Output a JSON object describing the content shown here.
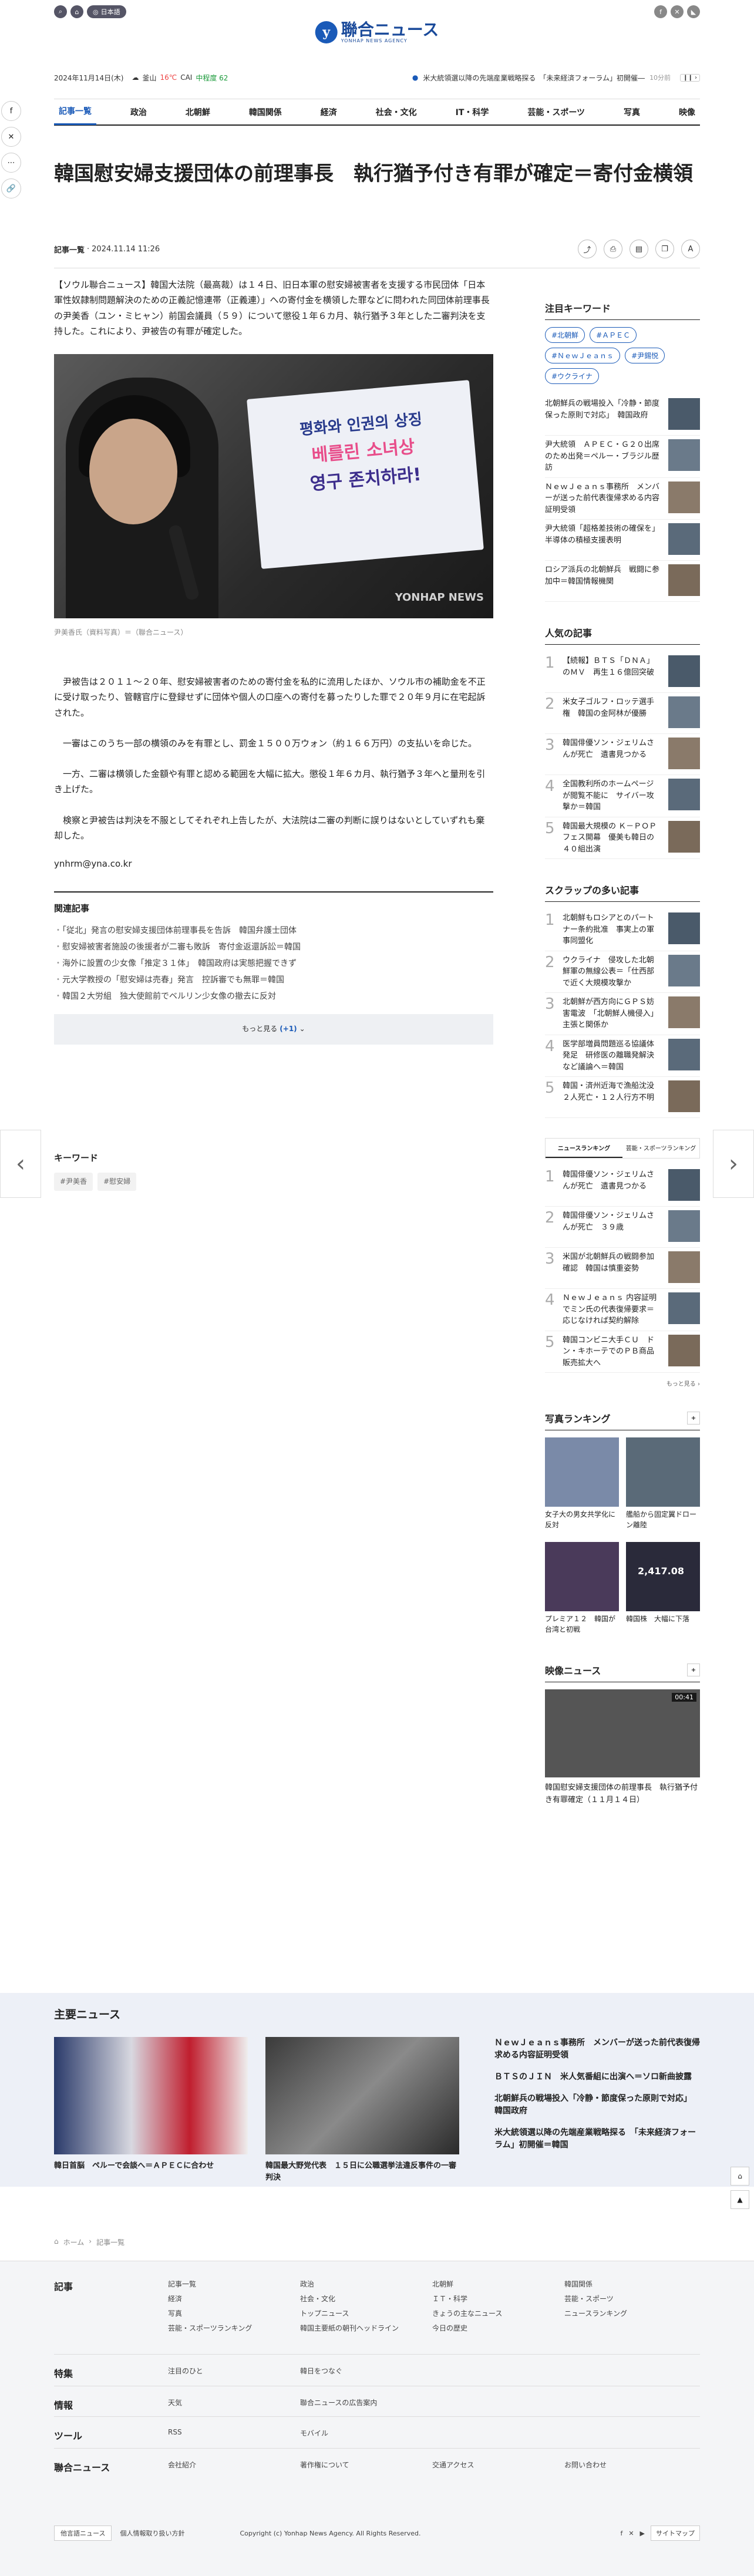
{
  "header": {
    "lang": "日本語",
    "logo": "聯合ニュース",
    "logo_sub": "YONHAP NEWS AGENCY"
  },
  "info": {
    "date": "2024年11月14日(木)",
    "city": "釜山",
    "temp": "16℃",
    "cai_label": "CAI",
    "cai": "中程度 62",
    "ticker": "米大統領選以降の先端産業戦略探る　「未来経済フォーラム」初開催―",
    "ago": "10分前"
  },
  "nav": [
    "記事一覧",
    "政治",
    "北朝鮮",
    "韓国関係",
    "経済",
    "社会・文化",
    "IT・科学",
    "芸能・スポーツ",
    "写真",
    "映像"
  ],
  "article": {
    "title": "韓国慰安婦支援団体の前理事長　執行猶予付き有罪が確定＝寄付金横領",
    "category": "記事一覧",
    "datetime": "2024.11.14 11:26",
    "lead": "【ソウル聯合ニュース】韓国大法院（最高裁）は１４日、旧日本軍の慰安婦被害者を支援する市民団体「日本軍性奴隷制問題解決のための正義記憶連帯（正義連）」への寄付金を横領した罪などに問われた同団体前理事長の尹美香（ユン・ミヒャン）前国会議員（５９）について懲役１年６カ月、執行猶予３年とした二審判決を支持した。これにより、尹被告の有罪が確定した。",
    "caption": "尹美香氏（資料写真）＝（聯合ニュース）",
    "p1": "尹被告は２０１１～２０年、慰安婦被害者のための寄付金を私的に流用したほか、ソウル市の補助金を不正に受け取ったり、管轄官庁に登録せずに団体や個人の口座への寄付を募ったりした罪で２０年９月に在宅起訴された。",
    "p2": "一審はこのうち一部の横領のみを有罪とし、罰金１５００万ウォン（約１６６万円）の支払いを命じた。",
    "p3": "一方、二審は横領した金額や有罪と認める範囲を大幅に拡大。懲役１年６カ月、執行猶予３年へと量刑を引き上げた。",
    "p4": "検察と尹被告は判決を不服としてそれぞれ上告したが、大法院は二審の判断に誤りはないとしていずれも棄却した。",
    "email": "ynhrm@yna.co.kr",
    "sign": {
      "l1": "평화와 인권의 상징",
      "l2": "베를린 소녀상",
      "l3": "영구 존치하라!"
    },
    "watermark": "YONHAP NEWS"
  },
  "related": {
    "heading": "関連記事",
    "items": [
      "「従北」発言の慰安婦支援団体前理事長を告訴　韓国弁護士団体",
      "慰安婦被害者施設の後援者が二審も敗訴　寄付金返還訴訟＝韓国",
      "海外に設置の少女像「推定３１体」　韓国政府は実態把握できず",
      "元大学教授の「慰安婦は売春」発言　控訴審でも無罪＝韓国",
      "韓国２大労組　独大使館前でベルリン少女像の撤去に反対"
    ],
    "more": "もっと見る",
    "more_count": "(+1)"
  },
  "keywords": {
    "heading": "キーワード",
    "tags": [
      "#尹美香",
      "#慰安婦"
    ]
  },
  "sidebar": {
    "hot_kw": {
      "heading": "注目キーワード",
      "tags": [
        "#北朝鮮",
        "#ＡＰＥＣ",
        "#ＮｅｗＪｅａｎｓ",
        "#尹錫悦",
        "#ウクライナ"
      ],
      "items": [
        "北朝鮮兵の戦場投入「冷静・節度保った原則で対応」　韓国政府",
        "尹大統領　ＡＰＥＣ・Ｇ２０出席のため出発＝ペルー・ブラジル歴訪",
        "ＮｅｗＪｅａｎｓ事務所　メンバーが送った前代表復帰求める内容証明受領",
        "尹大統領「超格差技術の確保を」　半導体の積極支援表明",
        "ロシア派兵の北朝鮮兵　戦闘に参加中＝韓国情報機関"
      ]
    },
    "popular": {
      "heading": "人気の記事",
      "items": [
        "【続報】ＢＴＳ「ＤＮＡ」のＭＶ　再生１６億回突破",
        "米女子ゴルフ・ロッテ選手権　韓国の金阿林が優勝",
        "韓国俳優ソン・ジェリムさんが死亡　遺書見つかる",
        "全国教利所のホームページが閲覧不能に　サイバー攻撃か＝韓国",
        "韓国最大規模の Ｋ－ＰＯＰフェス開幕　優美も韓日の４０組出演"
      ]
    },
    "scrap": {
      "heading": "スクラップの多い記事",
      "items": [
        "北朝鮮もロシアとのパートナー条約批准　事実上の軍事同盟化",
        "ウクライナ　侵攻した北朝鮮軍の無線公表＝「仕西部で近く大規模攻撃か",
        "北朝鮮が西方向にＧＰＳ妨害電波　「北朝鮮人機侵入」主張と関係か",
        "医学部増員問題巡る協議体発足　研修医の離職発解決など議論へ＝韓国",
        "韓国・済州近海で漁船沈没　２人死亡・１２人行方不明"
      ]
    },
    "tabs": [
      "ニュースランキング",
      "芸能・スポーツランキング"
    ],
    "ranking": {
      "items": [
        "韓国俳優ソン・ジェリムさんが死亡　遺書見つかる",
        "韓国俳優ソン・ジェリムさんが死亡　３９歳",
        "米国が北朝鮮兵の戦闘参加確認　韓国は慎重姿勢",
        "ＮｅｗＪｅａｎｓ 内容証明でミン氏の代表復帰要求＝応じなければ契約解除",
        "韓国コンビニ大手ＣＵ　ドン・キホーテでのＰＢ商品販売拡大へ"
      ],
      "more": "もっと見る"
    },
    "photo_rank": {
      "heading": "写真ランキング",
      "items": [
        "女子大の男女共学化に反対",
        "艦船から固定翼ドローン離陸",
        "プレミア１２　韓国が台湾と初戦",
        "韓国株　大幅に下落"
      ],
      "counter": "2,417.08"
    },
    "video": {
      "heading": "映像ニュース",
      "duration": "00:41",
      "title": "韓国慰安婦支援団体の前理事長　執行猶予付き有罪確定（１１月１４日）"
    }
  },
  "major": {
    "heading": "主要ニュース",
    "cards": [
      "韓日首脳　ペルーで会談へ＝ＡＰＥＣに合わせ",
      "韓国最大野党代表　１５日に公職選挙法違反事件の一審判決"
    ],
    "list": [
      "ＮｅｗＪｅａｎｓ事務所　メンバーが送った前代表復帰求める内容証明受領",
      "ＢＴＳのＪＩＮ　米人気番組に出演へ＝ソロ新曲披露",
      "北朝鮮兵の戦場投入「冷静・節度保った原則で対応」　韓国政府",
      "米大統領選以降の先端産業戦略探る　「未来経済フォーラム」初開催＝韓国"
    ]
  },
  "breadcrumb": {
    "home": "ホーム",
    "current": "記事一覧"
  },
  "footer": {
    "sections": [
      {
        "h": "記事",
        "links": [
          "記事一覧",
          "政治",
          "北朝鮮",
          "韓国関係",
          "経済",
          "社会・文化",
          "ＩＴ・科学",
          "芸能・スポーツ",
          "写真",
          "トップニュース",
          "きょうの主なニュース",
          "ニュースランキング",
          "芸能・スポーツランキング",
          "韓国主要紙の朝刊ヘッドライン",
          "今日の歴史"
        ]
      },
      {
        "h": "特集",
        "links": [
          "注目のひと",
          "韓日をつなぐ"
        ]
      },
      {
        "h": "情報",
        "links": [
          "天気",
          "聯合ニュースの広告案内"
        ]
      },
      {
        "h": "ツール",
        "links": [
          "RSS",
          "モバイル"
        ]
      },
      {
        "h": "聯合ニュース",
        "links": [
          "会社紹介",
          "著作権について",
          "交通アクセス",
          "お問い合わせ"
        ]
      }
    ],
    "sel": "他言語ニュース",
    "privacy": "個人情報取り扱い方針",
    "copyright": "Copyright (c) Yonhap News Agency. All Rights Reserved.",
    "sitemap": "サイトマップ"
  }
}
